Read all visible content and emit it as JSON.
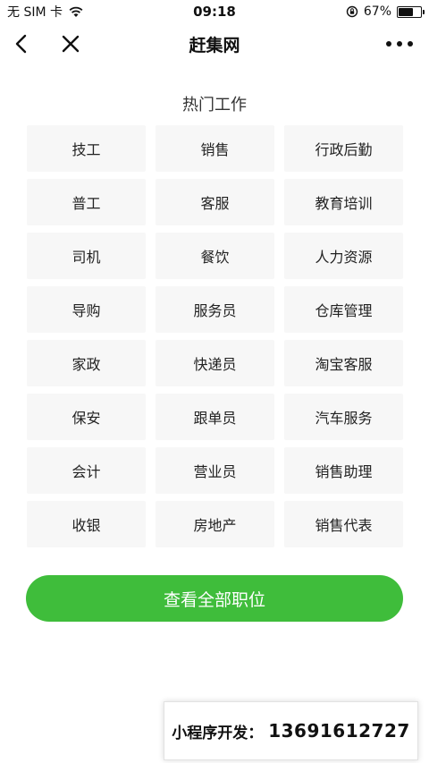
{
  "status_bar": {
    "carrier": "无 SIM 卡",
    "time": "09:18",
    "battery_percent": "67%",
    "battery_level": 0.67
  },
  "nav": {
    "title": "赶集网"
  },
  "section": {
    "title": "热门工作"
  },
  "jobs": [
    "技工",
    "销售",
    "行政后勤",
    "普工",
    "客服",
    "教育培训",
    "司机",
    "餐饮",
    "人力资源",
    "导购",
    "服务员",
    "仓库管理",
    "家政",
    "快递员",
    "淘宝客服",
    "保安",
    "跟单员",
    "汽车服务",
    "会计",
    "营业员",
    "销售助理",
    "收银",
    "房地产",
    "销售代表"
  ],
  "view_all_label": "查看全部职位",
  "promo": {
    "label": "小程序开发：",
    "phone": "13691612727"
  },
  "colors": {
    "accent_green": "#3fbd3b",
    "cell_bg": "#f7f7f7"
  }
}
